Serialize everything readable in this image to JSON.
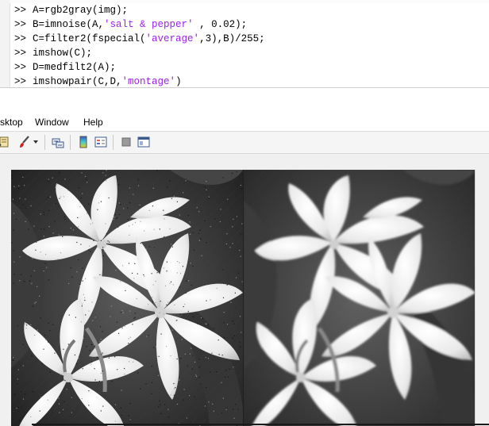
{
  "command_window": {
    "prompt": ">>",
    "lines": [
      {
        "parts": [
          {
            "text": "A=rgb2gray(img);",
            "type": "code"
          }
        ]
      },
      {
        "parts": [
          {
            "text": "B=imnoise(A,",
            "type": "code"
          },
          {
            "text": "'salt & pepper'",
            "type": "str"
          },
          {
            "text": " , 0.02);",
            "type": "code"
          }
        ]
      },
      {
        "parts": [
          {
            "text": "C=filter2(fspecial(",
            "type": "code"
          },
          {
            "text": "'average'",
            "type": "str"
          },
          {
            "text": ",3),B)/255;",
            "type": "code"
          }
        ]
      },
      {
        "parts": [
          {
            "text": "imshow(C);",
            "type": "code"
          }
        ]
      },
      {
        "parts": [
          {
            "text": "D=medfilt2(A);",
            "type": "code"
          }
        ]
      },
      {
        "parts": [
          {
            "text": "imshowpair(C,D,",
            "type": "code"
          },
          {
            "text": "'montage'",
            "type": "str"
          },
          {
            "text": ")",
            "type": "code"
          }
        ]
      }
    ]
  },
  "figure": {
    "menu": {
      "desktop": "sktop",
      "window": "Window",
      "help": "Help"
    },
    "toolbar_icons": [
      "edit-plot-icon",
      "brush-icon",
      "dropdown-arrow-icon",
      "link-plot-icon",
      "colorbar-icon",
      "legend-icon",
      "hide-plot-tools-icon",
      "show-plot-tools-icon"
    ],
    "colors": {
      "string": "#a020f0",
      "toolbar_bg": "#f5f5f5",
      "figure_bg": "#f0f0f0"
    }
  }
}
